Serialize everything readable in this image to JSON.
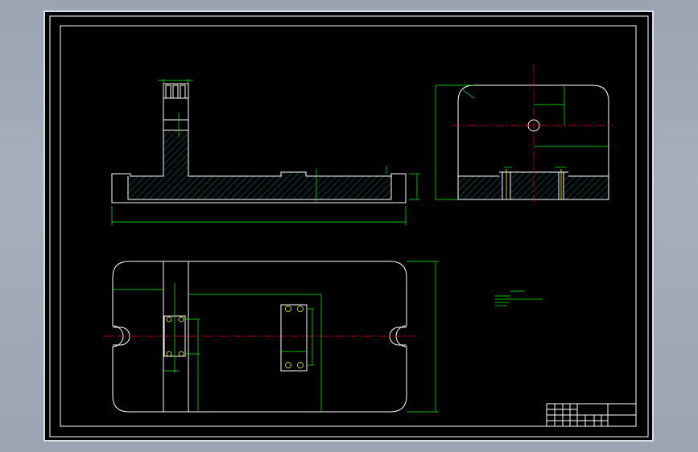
{
  "sheet": {
    "background": "#000000",
    "border_color": "#ffffff",
    "outline_color": "#ffffff",
    "dimension_color": "#00ff00",
    "centerline_color": "#ff0000",
    "hole_color": "#ffff00",
    "hatch_color": "#00ffff",
    "frame_color": "#d8dce4"
  },
  "views": {
    "front_section": "front-section-view",
    "side_section": "side-section-view",
    "top": "top-view"
  }
}
